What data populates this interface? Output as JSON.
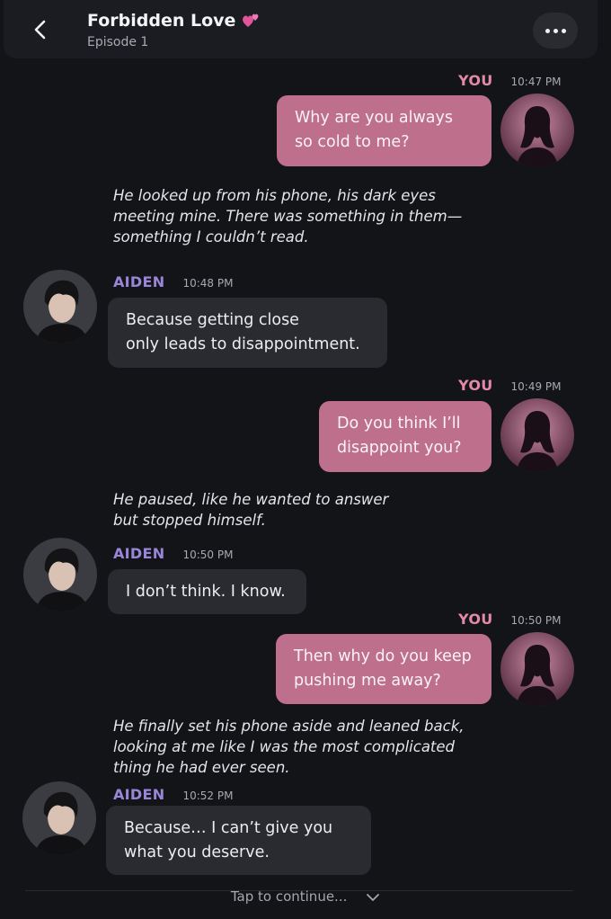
{
  "header": {
    "title": "Forbidden Love",
    "subtitle": "Episode 1",
    "back_icon": "chevron-left-icon",
    "heart_icon": "two-hearts-icon",
    "more_icon": "more-horizontal-icon"
  },
  "colors": {
    "background": "#131418",
    "you_bubble": "#bd6f8c",
    "aiden_bubble": "#2a2b30",
    "you_name": "#e38aa7",
    "aiden_name": "#9a86d9"
  },
  "messages": [
    {
      "sender": "YOU",
      "time": "10:47 PM",
      "text": "Why are you always\nso cold to me?"
    },
    {
      "narration": "He looked up from his phone, his dark eyes\nmeeting mine. There was something in them—\nsomething I couldn’t read."
    },
    {
      "sender": "AIDEN",
      "time": "10:48 PM",
      "text": "Because getting close\nonly leads to disappointment."
    },
    {
      "sender": "YOU",
      "time": "10:49 PM",
      "text": "Do you think I’ll\ndisappoint you?"
    },
    {
      "narration": "He paused, like he wanted to answer\nbut stopped himself."
    },
    {
      "sender": "AIDEN",
      "time": "10:50 PM",
      "text": "I don’t think. I know."
    },
    {
      "sender": "YOU",
      "time": "10:50 PM",
      "text": "Then why do you keep\npushing me away?"
    },
    {
      "narration": "He finally set his phone aside and leaned back,\nlooking at me like I was the most complicated\nthing he had ever seen."
    },
    {
      "sender": "AIDEN",
      "time": "10:52 PM",
      "text": "Because… I can’t give you\nwhat you deserve."
    }
  ],
  "footer": {
    "label": "Tap to continue...",
    "icon": "chevron-down-icon"
  }
}
